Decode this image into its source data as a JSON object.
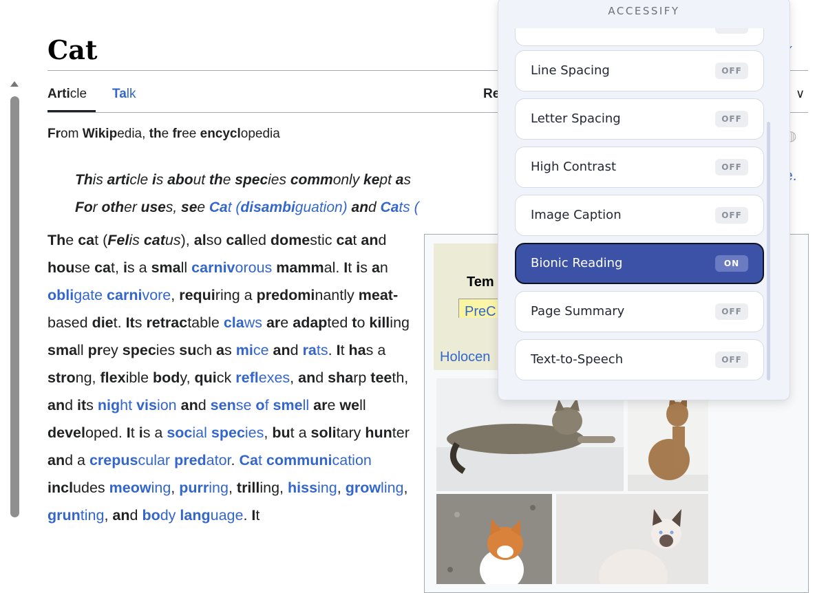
{
  "article": {
    "title": "Cat",
    "tabs": {
      "article": "Article",
      "talk": "Talk",
      "read": "Re"
    },
    "from": "From Wikipedia, the free encyclopedia",
    "hatnote_tail": "e."
  },
  "infobox": {
    "timeline_label": "Tem",
    "precambrian": "PreC",
    "holocene": "Holocen"
  },
  "accessify": {
    "title": "ACCESSIFY",
    "items": [
      {
        "label": "",
        "status": ""
      },
      {
        "label": "Line Spacing",
        "status": "OFF"
      },
      {
        "label": "Letter Spacing",
        "status": "OFF"
      },
      {
        "label": "High Contrast",
        "status": "OFF"
      },
      {
        "label": "Image Caption",
        "status": "OFF"
      },
      {
        "label": "Bionic Reading",
        "status": "ON"
      },
      {
        "label": "Page Summary",
        "status": "OFF"
      },
      {
        "label": "Text-to-Speech",
        "status": "OFF"
      }
    ]
  },
  "icons": {
    "scroll_up": "triangle-up-icon",
    "chevron": "chevron-down-icon",
    "check": "check-icon",
    "audio": "audio-icon"
  },
  "colors": {
    "link": "#3366cc",
    "active_item_bg": "#3c52a6",
    "panel_bg": "#f1f3fa"
  }
}
